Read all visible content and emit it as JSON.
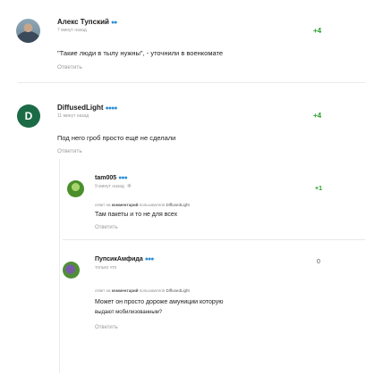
{
  "comments": [
    {
      "author": "Алекс Тупский",
      "badge": "●●",
      "time": "7 минут назад",
      "rating": "+4",
      "text": "\"Такие люди в тылу нужны\", - уточнили в военкомате",
      "reply": "Ответить"
    },
    {
      "author": "DiffusedLight",
      "badge": "●●●●",
      "avatar_letter": "D",
      "time": "11 минут назад",
      "rating": "+4",
      "text": "Под него гроб просто ещё не сделали",
      "reply": "Ответить"
    },
    {
      "author": "tam005",
      "badge": "●●●",
      "time": "9 минут назад",
      "rating": "+1",
      "context_prefix": "ответ на",
      "context_bold": "комментарий",
      "context_middle": "пользователя",
      "context_user": "DiffusedLight",
      "text": "Там пакеты и то не для всех",
      "reply": "Ответить"
    },
    {
      "author": "Пупсик‌Амфида",
      "badge": "●●●",
      "time": "только что",
      "rating": "0",
      "context_prefix": "ответ на",
      "context_bold": "комментарий",
      "context_middle": "пользователя",
      "context_user": "DiffusedLight",
      "text_line1": "Может он просто дороже амуниции которую",
      "text_line2": "выдают мобилизованным?",
      "reply": "Ответить"
    }
  ],
  "colors": {
    "rating_positive": "#27a02a",
    "badge": "#2e8fd6",
    "muted": "#9b9b9b"
  },
  "icons": {
    "time_suffix_icon": "snowflake-icon"
  }
}
